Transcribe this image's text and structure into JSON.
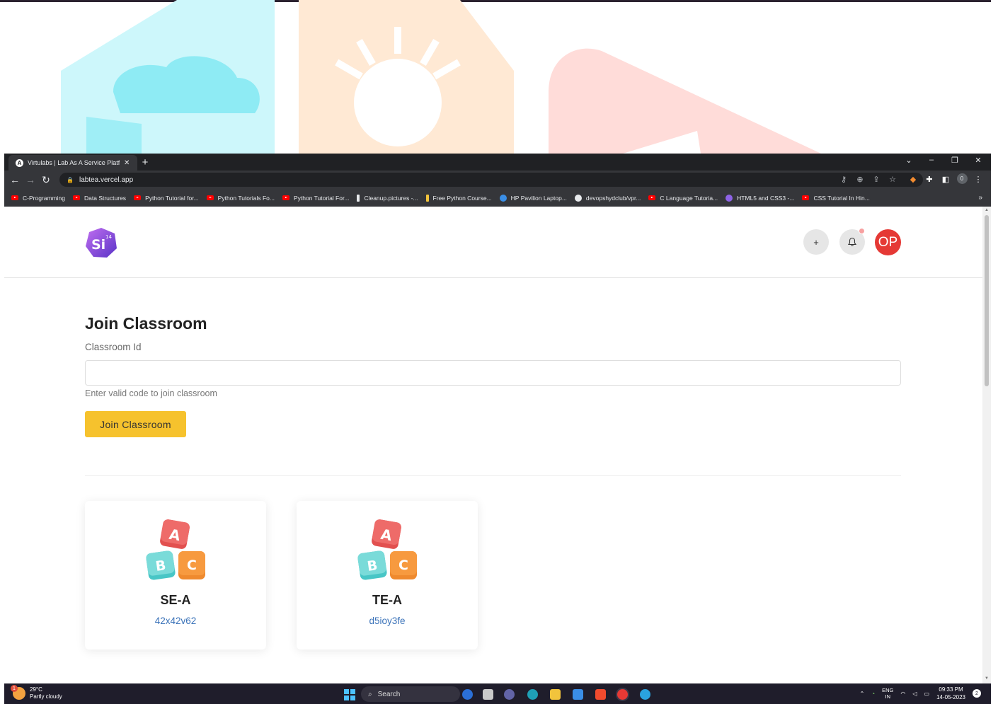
{
  "browser": {
    "tab_title": "Virtulabs | Lab As A Service Platf...",
    "tab_favicon": "A",
    "url": "labtea.vercel.app",
    "profile_initial": "0",
    "bookmarks": [
      {
        "label": "C-Programming",
        "icon": "youtube-icon"
      },
      {
        "label": "Data Structures",
        "icon": "youtube-icon"
      },
      {
        "label": "Python Tutorial for...",
        "icon": "youtube-icon"
      },
      {
        "label": "Python Tutorials Fo...",
        "icon": "youtube-icon"
      },
      {
        "label": "Python Tutorial For...",
        "icon": "youtube-icon"
      },
      {
        "label": "Cleanup.pictures -...",
        "icon": "brush-icon"
      },
      {
        "label": "Free Python Course...",
        "icon": "bar-icon"
      },
      {
        "label": "HP Pavilion Laptop...",
        "icon": "globe-icon"
      },
      {
        "label": "devopshydclub/vpr...",
        "icon": "github-icon"
      },
      {
        "label": "C Language Tutoria...",
        "icon": "youtube-icon"
      },
      {
        "label": "HTML5 and CSS3 -...",
        "icon": "purple-circle-icon"
      },
      {
        "label": "CSS Tutorial In Hin...",
        "icon": "youtube-icon"
      }
    ],
    "bookmarks_more": "»"
  },
  "header": {
    "logo_text": "Si",
    "logo_sup": "14",
    "add_label": "+",
    "avatar_initials": "OP"
  },
  "join": {
    "title": "Join Classroom",
    "field_label": "Classroom Id",
    "input_value": "",
    "hint": "Enter valid code to join classroom",
    "button_label": "Join Classroom"
  },
  "classrooms": [
    {
      "name": "SE-A",
      "code": "42x42v62"
    },
    {
      "name": "TE-A",
      "code": "d5ioy3fe"
    }
  ],
  "block_letters": [
    "A",
    "B",
    "C"
  ],
  "taskbar": {
    "temperature": "29°C",
    "weather": "Partly cloudy",
    "weather_badge": "1",
    "search_label": "Search",
    "lang_top": "ENG",
    "lang_bottom": "IN",
    "time": "09:33 PM",
    "date": "14-05-2023",
    "notification_count": "2"
  },
  "colors": {
    "accent_button": "#f6c22d",
    "avatar": "#e53935",
    "code_link": "#3b73b9",
    "chrome_bg": "#35363a",
    "taskbar_bg": "#1f1d2b"
  }
}
